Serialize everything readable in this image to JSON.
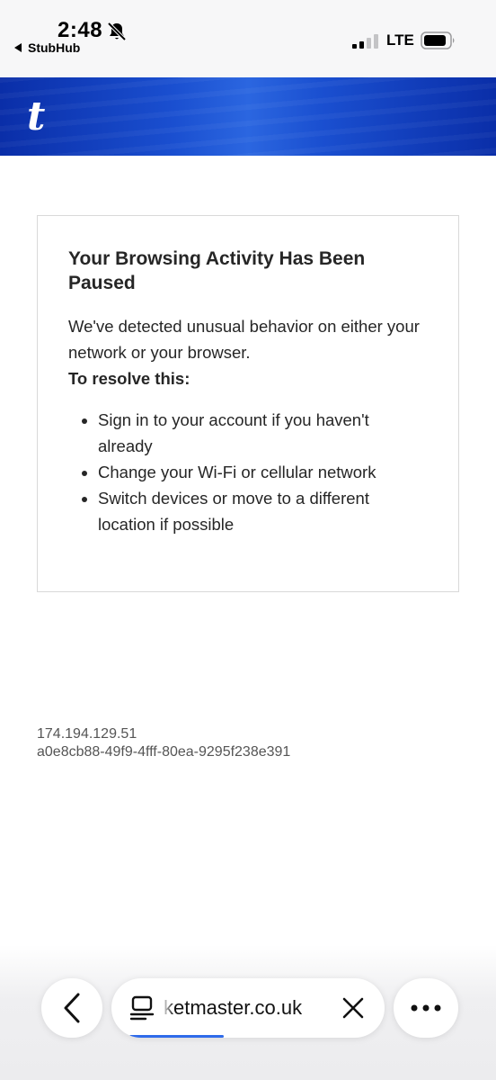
{
  "status_bar": {
    "time": "2:48",
    "back_app_label": "StubHub",
    "network": "LTE",
    "icons": [
      "bell-slash-icon",
      "signal-icon",
      "battery-icon"
    ]
  },
  "banner": {
    "logo_letter": "t",
    "color": "#1a4fd0"
  },
  "message": {
    "title": "Your Browsing Activity Has Been Paused",
    "body": "We've detected unusual behavior on either your network or your browser.",
    "subheading": "To resolve this:",
    "steps": [
      "Sign in to your account if you haven't already",
      "Change your Wi-Fi or cellular network",
      "Switch devices or move to a different location if possible"
    ]
  },
  "reference": {
    "ip_address": "174.194.129.51",
    "request_id": "a0e8cb88-49f9-4fff-80ea-9295f238e391"
  },
  "browser_bar": {
    "url_display": "ketmaster.co.uk",
    "page_load_progress": 0.35,
    "progress_color": "#2f6bea",
    "icons": [
      "back-chevron-icon",
      "tabs-icon",
      "close-icon",
      "more-icon"
    ]
  }
}
